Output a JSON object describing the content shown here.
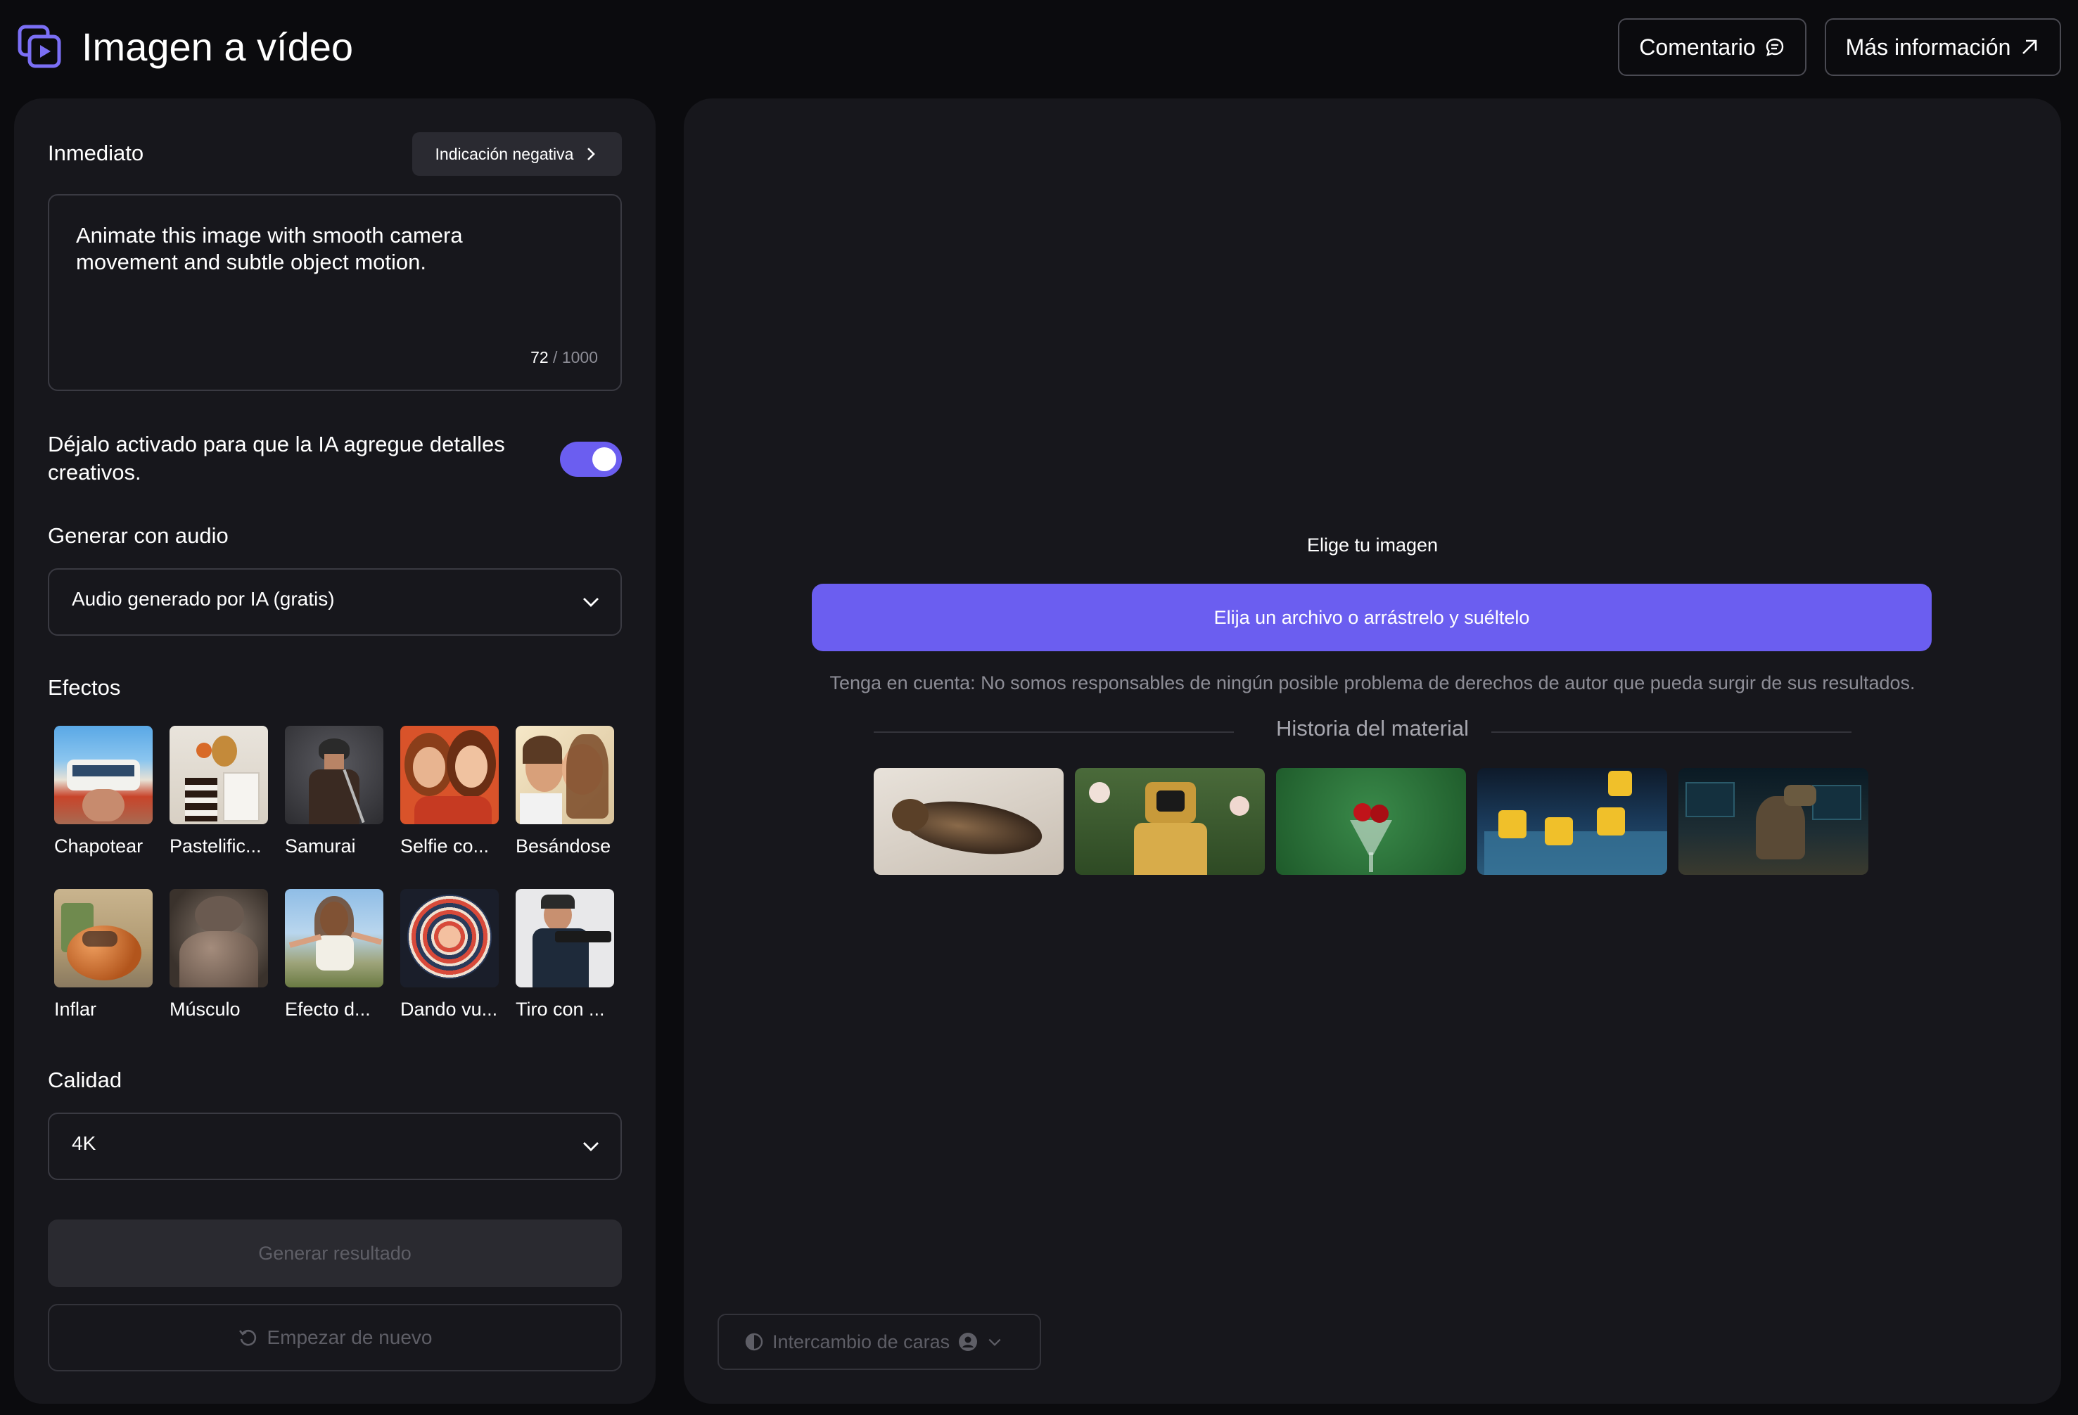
{
  "header": {
    "title": "Imagen a vídeo",
    "comment_label": "Comentario",
    "more_info_label": "Más información"
  },
  "prompt": {
    "label": "Inmediato",
    "negative_label": "Indicación negativa",
    "text": "Animate this image with smooth camera movement and subtle object motion.",
    "count": "72",
    "max": "/ 1000"
  },
  "toggle": {
    "label": "Déjalo activado para que la IA agregue detalles creativos.",
    "on": true
  },
  "audio": {
    "label": "Generar con audio",
    "value": "Audio generado por IA (gratis)"
  },
  "effects": {
    "label": "Efectos",
    "items": [
      {
        "label": "Chapotear",
        "icon": "van-splash-thumb"
      },
      {
        "label": "Pastelific...",
        "icon": "cake-thumb"
      },
      {
        "label": "Samurai",
        "icon": "samurai-thumb"
      },
      {
        "label": "Selfie co...",
        "icon": "selfie-thumb"
      },
      {
        "label": "Besándose",
        "icon": "kiss-thumb"
      },
      {
        "label": "Inflar",
        "icon": "inflate-car-thumb"
      },
      {
        "label": "Músculo",
        "icon": "muscle-thumb"
      },
      {
        "label": "Efecto d...",
        "icon": "woman-effect-thumb"
      },
      {
        "label": "Dando vu...",
        "icon": "spin-thumb"
      },
      {
        "label": "Tiro con ...",
        "icon": "shooting-thumb"
      }
    ]
  },
  "quality": {
    "label": "Calidad",
    "value": "4K"
  },
  "actions": {
    "generate_label": "Generar resultado",
    "restart_label": "Empezar de nuevo"
  },
  "upload": {
    "choose_label": "Elige tu imagen",
    "button_label": "Elija un archivo o arrástrelo y suéltelo",
    "notice": "Tenga en cuenta: No somos responsables de ningún posible problema de derechos de autor que pueda surgir de sus resultados."
  },
  "history": {
    "title": "Historia del material",
    "items": [
      "cat-thumb",
      "robot-thumb",
      "cherry-thumb",
      "lego-pool-thumb",
      "dinosaur-thumb"
    ]
  },
  "face_swap": {
    "label": "Intercambio de caras"
  },
  "colors": {
    "accent": "#6b5ef0",
    "background": "#0b0b0e",
    "panel": "#17171c"
  }
}
